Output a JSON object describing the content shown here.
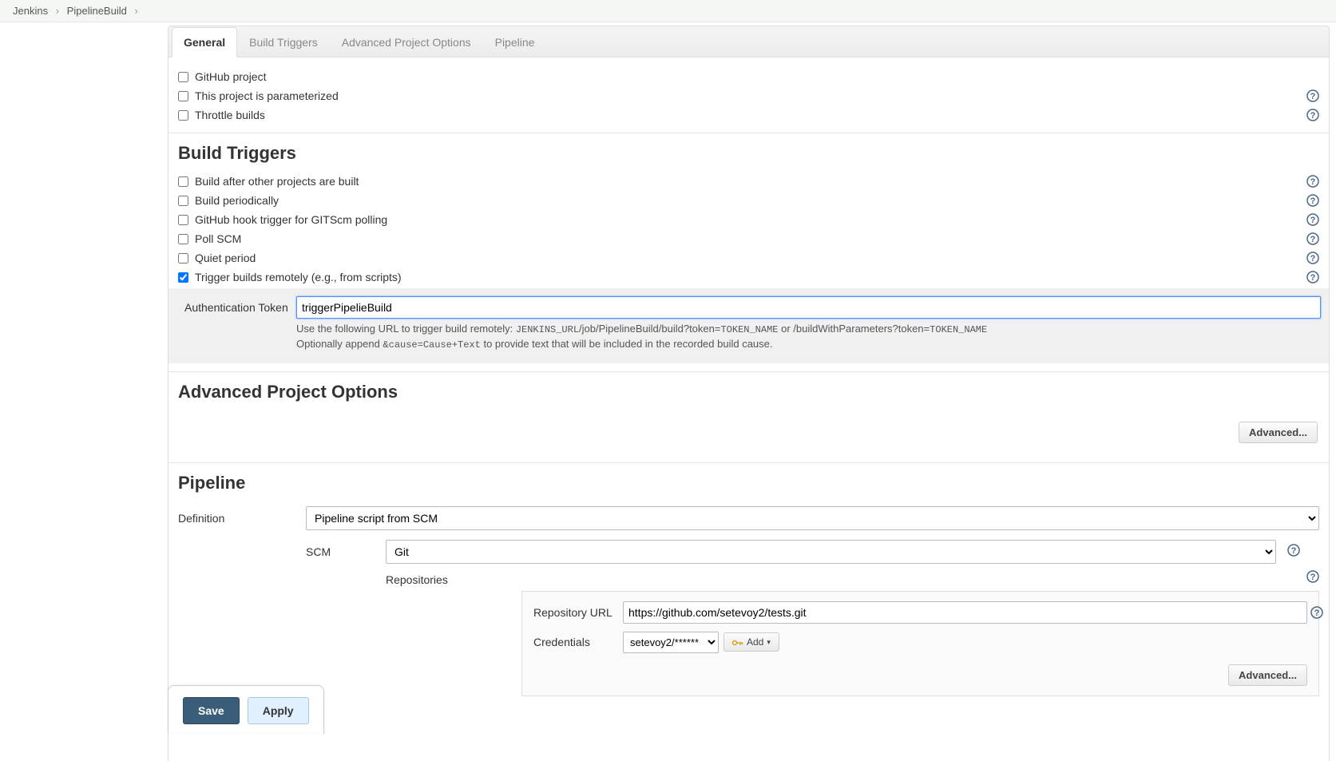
{
  "breadcrumb": {
    "root": "Jenkins",
    "job": "PipelineBuild"
  },
  "tabs": {
    "general": "General",
    "triggers": "Build Triggers",
    "advanced": "Advanced Project Options",
    "pipeline": "Pipeline"
  },
  "general": {
    "github_project": "GitHub project",
    "parameterized": "This project is parameterized",
    "throttle": "Throttle builds"
  },
  "sections": {
    "build_triggers": "Build Triggers",
    "advanced_options": "Advanced Project Options",
    "pipeline": "Pipeline"
  },
  "triggers": {
    "after_other": "Build after other projects are built",
    "periodically": "Build periodically",
    "github_hook": "GitHub hook trigger for GITScm polling",
    "poll_scm": "Poll SCM",
    "quiet_period": "Quiet period",
    "remote": "Trigger builds remotely (e.g., from scripts)"
  },
  "auth_token": {
    "label": "Authentication Token",
    "value": "triggerPipelieBuild",
    "hint_pre": "Use the following URL to trigger build remotely: ",
    "hint_mono1": "JENKINS_URL",
    "hint_mid1": "/job/PipelineBuild/build?token=",
    "hint_mono2": "TOKEN_NAME",
    "hint_mid2": " or /buildWithParameters?token=",
    "hint_mono3": "TOKEN_NAME",
    "hint_line2a": "Optionally append ",
    "hint_mono4": "&cause=Cause+Text",
    "hint_line2b": " to provide text that will be included in the recorded build cause."
  },
  "buttons": {
    "advanced": "Advanced...",
    "add": "Add",
    "save": "Save",
    "apply": "Apply"
  },
  "pipeline": {
    "definition_label": "Definition",
    "definition_value": "Pipeline script from SCM",
    "scm_label": "SCM",
    "scm_value": "Git",
    "repositories_label": "Repositories",
    "repo_url_label": "Repository URL",
    "repo_url_value": "https://github.com/setevoy2/tests.git",
    "credentials_label": "Credentials",
    "credentials_value": "setevoy2/******"
  }
}
